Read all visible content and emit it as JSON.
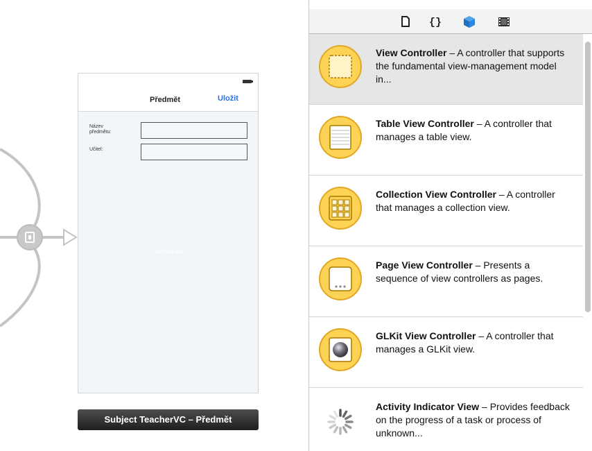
{
  "storyboard": {
    "scene": {
      "nav_title": "Předmět",
      "nav_save": "Uložit",
      "fields": [
        {
          "label": "Název předmětu:"
        },
        {
          "label": "Učitel:"
        }
      ],
      "ghost_text": "View Controller"
    },
    "scene_label": "Subject TeacherVC – Předmět"
  },
  "library": {
    "tabs": [
      {
        "icon": "file-template-icon"
      },
      {
        "icon": "code-snippet-icon"
      },
      {
        "icon": "object-library-icon",
        "selected": true
      },
      {
        "icon": "media-library-icon"
      }
    ],
    "items": [
      {
        "title": "View Controller",
        "description": " – A controller that supports the fundamental view-management model in...",
        "icon": "view-controller-icon",
        "selected": true
      },
      {
        "title": "Table View Controller",
        "description": " – A controller that manages a table view.",
        "icon": "table-view-controller-icon"
      },
      {
        "title": "Collection View Controller",
        "description": " – A controller that manages a collection view.",
        "icon": "collection-view-controller-icon"
      },
      {
        "title": "Page View Controller",
        "description": " – Presents a sequence of view controllers as pages.",
        "icon": "page-view-controller-icon"
      },
      {
        "title": "GLKit View Controller",
        "description": " – A controller that manages a GLKit view.",
        "icon": "glkit-view-controller-icon"
      },
      {
        "title": "Activity Indicator View",
        "description": " – Provides feedback on the progress of a task or process of unknown...",
        "icon": "activity-indicator-icon"
      }
    ]
  },
  "colors": {
    "accent_blue": "#2a6ff0",
    "library_icon_fill": "#fcd355",
    "library_icon_ring": "#e2a722",
    "selected_row": "#e6e6e6"
  }
}
